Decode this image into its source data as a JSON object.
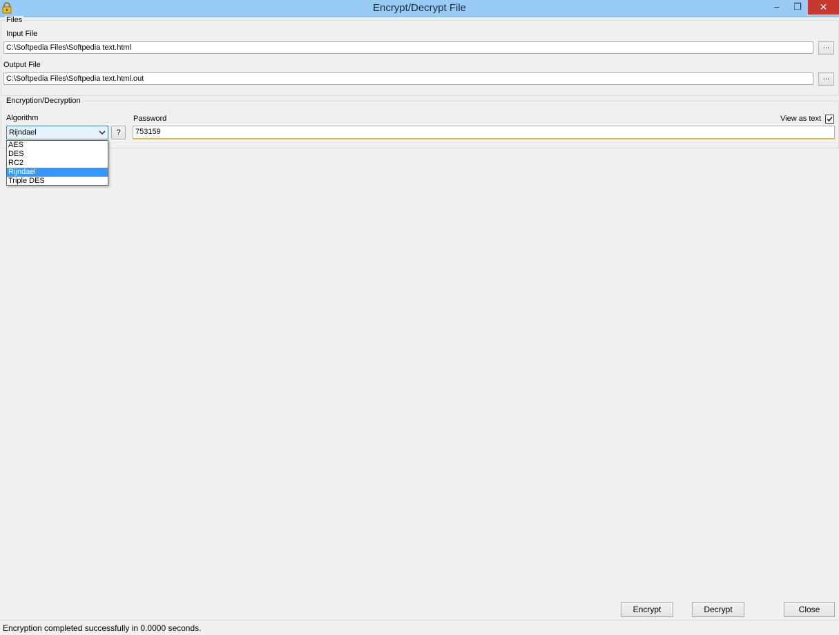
{
  "window": {
    "title": "Encrypt/Decrypt File",
    "controls": {
      "minimize": "–",
      "maximize": "❐",
      "close": "✕"
    }
  },
  "files": {
    "group_label": "Files",
    "input_label": "Input File",
    "input_value": "C:\\Softpedia Files\\Softpedia text.html",
    "output_label": "Output File",
    "output_value": "C:\\Softpedia Files\\Softpedia text.html.out",
    "browse_label": "..."
  },
  "crypto": {
    "group_label": "Encryption/Decryption",
    "algorithm_label": "Algorithm",
    "algorithm_selected": "Rijndael",
    "algorithm_options": [
      "AES",
      "DES",
      "RC2",
      "Rijndael",
      "Triple DES"
    ],
    "help_label": "?",
    "password_label": "Password",
    "password_value": "753159",
    "view_as_text_label": "View as text",
    "view_as_text_checked": true
  },
  "actions": {
    "encrypt": "Encrypt",
    "decrypt": "Decrypt",
    "close": "Close"
  },
  "status": {
    "message": "Encryption completed successfully in 0.0000 seconds."
  },
  "colors": {
    "titlebar": "#99ccf4",
    "close_button": "#c7382e",
    "selection": "#3399ff",
    "focus_underline": "#e2bb3c"
  }
}
